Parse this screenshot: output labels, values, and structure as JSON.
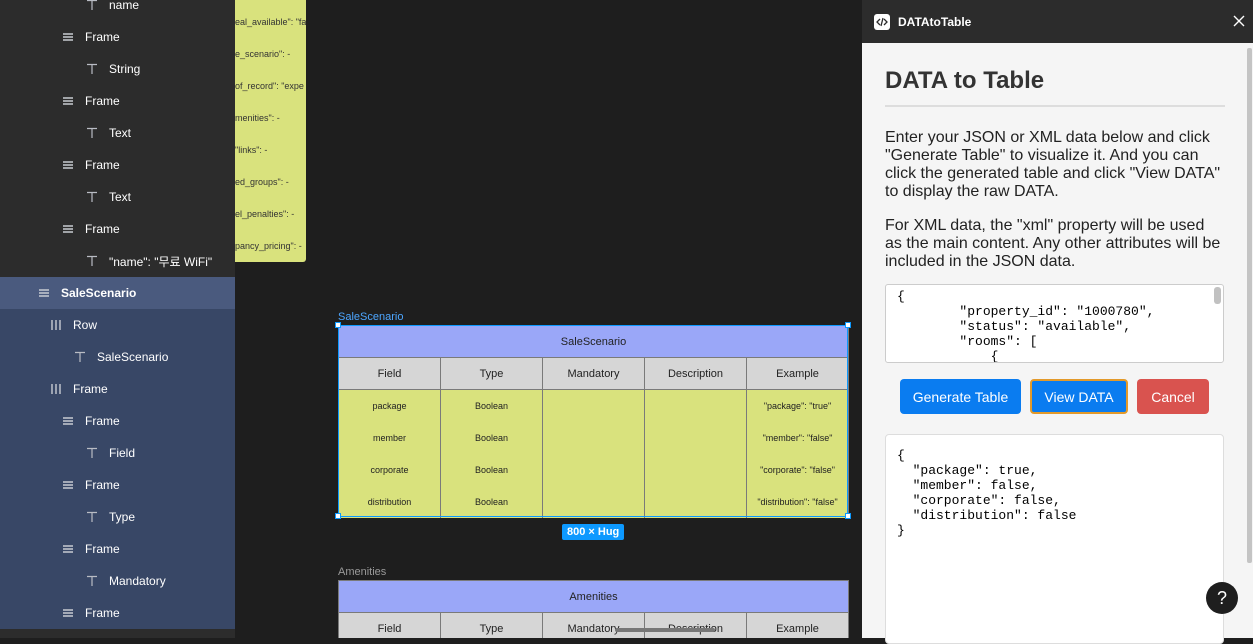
{
  "layers": [
    {
      "label": "name",
      "icon": "text-icon",
      "indent": 1,
      "state": "dark"
    },
    {
      "label": "Frame",
      "icon": "frame-icon",
      "indent": 0,
      "state": "dark"
    },
    {
      "label": "String",
      "icon": "text-icon",
      "indent": 1,
      "state": "dark"
    },
    {
      "label": "Frame",
      "icon": "frame-icon",
      "indent": 0,
      "state": "dark"
    },
    {
      "label": "Text",
      "icon": "text-icon",
      "indent": 1,
      "state": "dark"
    },
    {
      "label": "Frame",
      "icon": "frame-icon",
      "indent": 0,
      "state": "dark"
    },
    {
      "label": "Text",
      "icon": "text-icon",
      "indent": 1,
      "state": "dark"
    },
    {
      "label": "Frame",
      "icon": "frame-icon",
      "indent": 0,
      "state": "dark"
    },
    {
      "label": "\"name\": \"무료 WiFi\"",
      "icon": "text-icon",
      "indent": 1,
      "state": "dark"
    },
    {
      "label": "SaleScenario",
      "icon": "frame-icon",
      "indent": -1,
      "state": "main"
    },
    {
      "label": "Row",
      "icon": "row-icon",
      "indent": -0.5,
      "state": "light"
    },
    {
      "label": "SaleScenario",
      "icon": "text-icon",
      "indent": 0.5,
      "state": "light"
    },
    {
      "label": "Frame",
      "icon": "row-icon",
      "indent": -0.5,
      "state": "light"
    },
    {
      "label": "Frame",
      "icon": "frame-icon",
      "indent": 0,
      "state": "light"
    },
    {
      "label": "Field",
      "icon": "text-icon",
      "indent": 1,
      "state": "light"
    },
    {
      "label": "Frame",
      "icon": "frame-icon",
      "indent": 0,
      "state": "light"
    },
    {
      "label": "Type",
      "icon": "text-icon",
      "indent": 1,
      "state": "light"
    },
    {
      "label": "Frame",
      "icon": "frame-icon",
      "indent": 0,
      "state": "light"
    },
    {
      "label": "Mandatory",
      "icon": "text-icon",
      "indent": 1,
      "state": "light"
    },
    {
      "label": "Frame",
      "icon": "frame-icon",
      "indent": 0,
      "state": "light"
    }
  ],
  "canvas": {
    "partial_table_cells": [
      "eal_available\": \"fa",
      "e_scenario\": -",
      "of_record\": \"expe",
      "menities\": -",
      "\"links\": -",
      "ed_groups\": -",
      "el_penalties\": -",
      "pancy_pricing\": -"
    ],
    "sale_table": {
      "frame_label": "SaleScenario",
      "title": "SaleScenario",
      "headers": [
        "Field",
        "Type",
        "Mandatory",
        "Description",
        "Example"
      ],
      "rows": [
        [
          "package",
          "Boolean",
          "",
          "",
          "\"package\": \"true\""
        ],
        [
          "member",
          "Boolean",
          "",
          "",
          "\"member\": \"false\""
        ],
        [
          "corporate",
          "Boolean",
          "",
          "",
          "\"corporate\": \"false\""
        ],
        [
          "distribution",
          "Boolean",
          "",
          "",
          "\"distribution\": \"false\""
        ]
      ],
      "size_badge": "800 × Hug"
    },
    "amenities_table": {
      "frame_label": "Amenities",
      "title": "Amenities",
      "headers": [
        "Field",
        "Type",
        "Mandatory",
        "Description",
        "Example"
      ]
    }
  },
  "plugin": {
    "name": "DATAtoTable",
    "title": "DATA to Table",
    "para1": "Enter your JSON or XML data below and click \"Generate Table\" to visualize it. And you can click the generated table and click \"View DATA\" to display the raw DATA.",
    "para2": "For XML data, the \"xml\" property will be used as the main content. Any other attributes will be included in the JSON data.",
    "input_value": "{\n        \"property_id\": \"1000780\",\n        \"status\": \"available\",\n        \"rooms\": [\n            {",
    "buttons": {
      "generate": "Generate Table",
      "view": "View DATA",
      "cancel": "Cancel"
    },
    "output": "{\n  \"package\": true,\n  \"member\": false,\n  \"corporate\": false,\n  \"distribution\": false\n}",
    "help": "?"
  },
  "colors": {
    "accent": "#0d99ff",
    "table_title": "#9aa7f8",
    "table_cell": "#d9e27d",
    "generate": "#0a7cf0",
    "view": "#0a7cf0",
    "cancel": "#d9534f"
  }
}
